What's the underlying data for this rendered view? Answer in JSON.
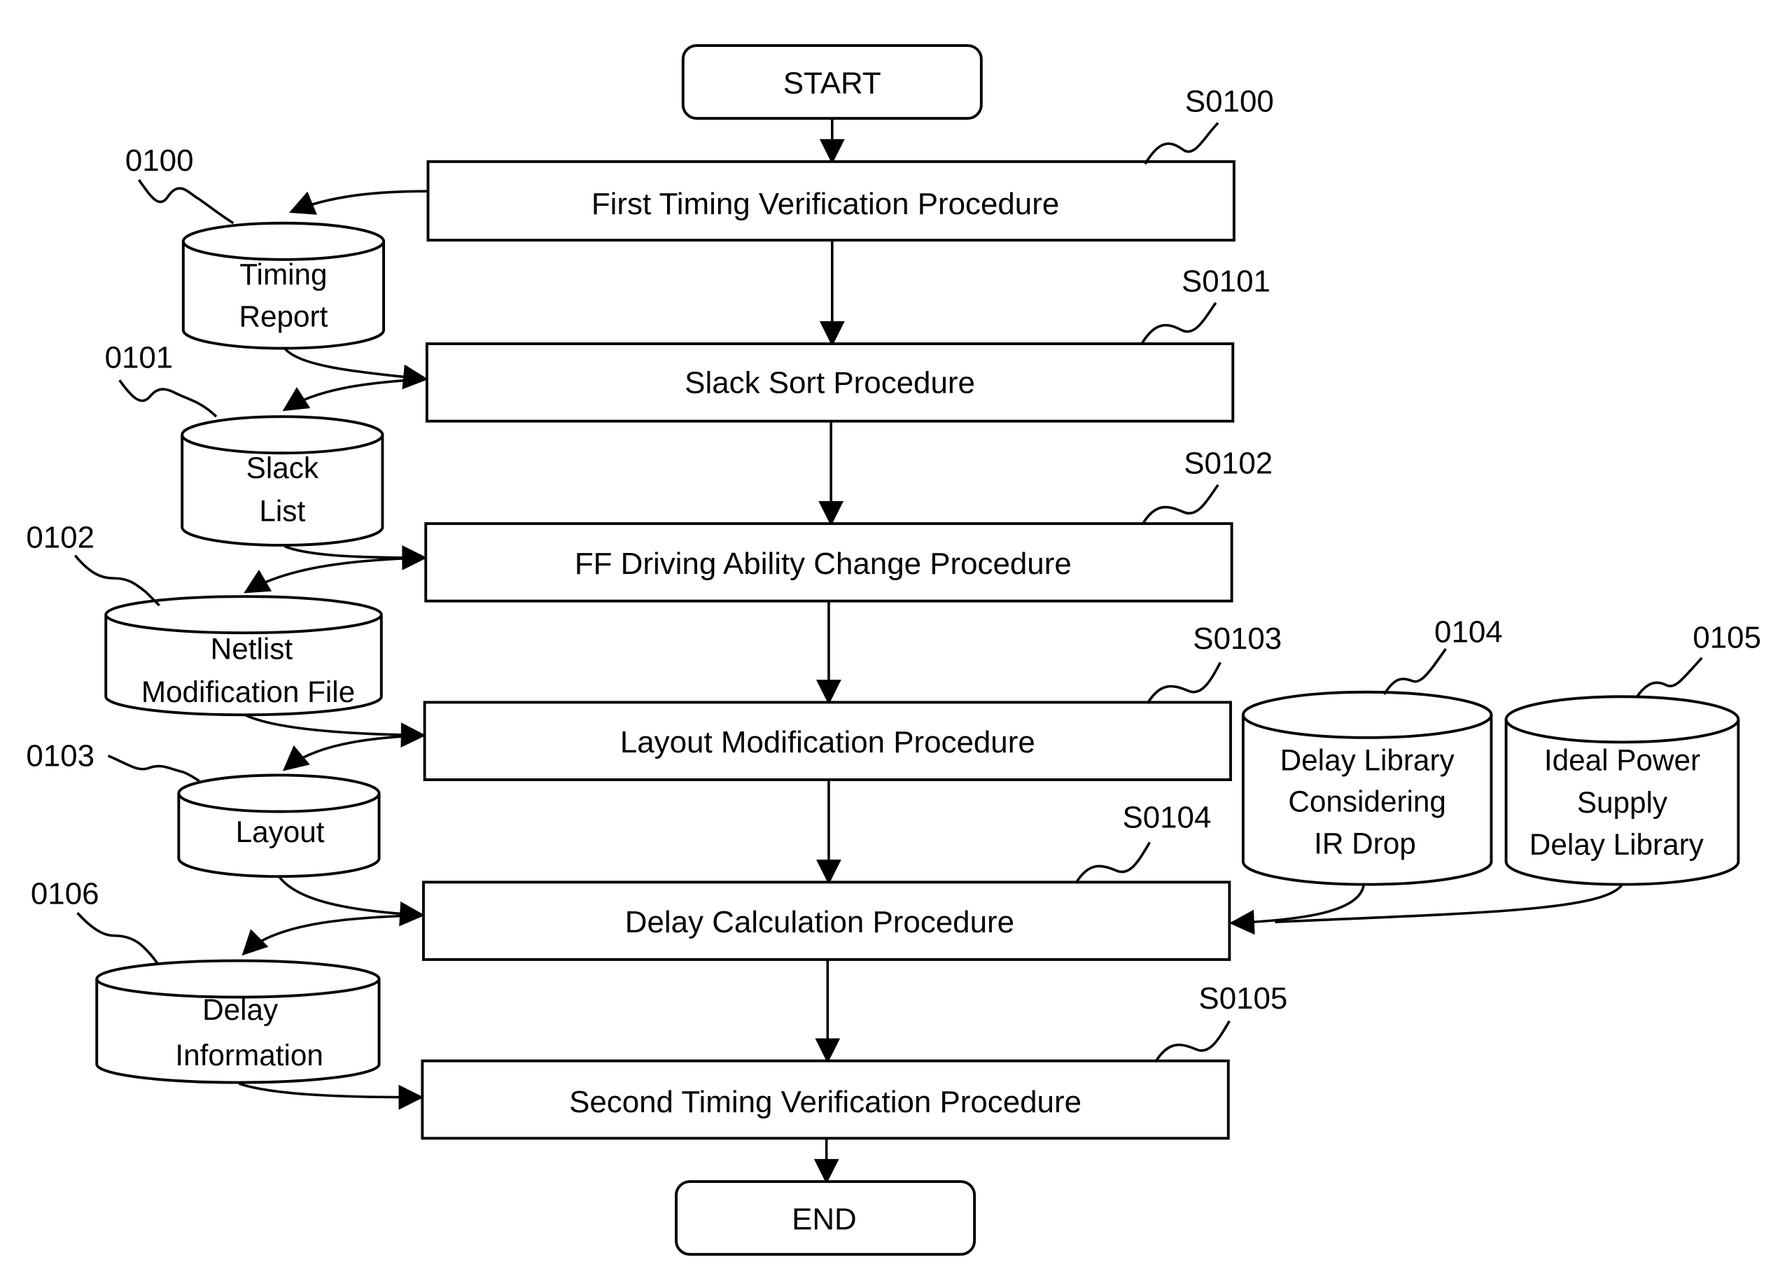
{
  "terminals": {
    "start": "START",
    "end": "END"
  },
  "steps": [
    {
      "id": "S0100",
      "label": "First Timing Verification Procedure"
    },
    {
      "id": "S0101",
      "label": "Slack Sort Procedure"
    },
    {
      "id": "S0102",
      "label": "FF Driving Ability Change Procedure"
    },
    {
      "id": "S0103",
      "label": "Layout Modification Procedure"
    },
    {
      "id": "S0104",
      "label": "Delay Calculation Procedure"
    },
    {
      "id": "S0105",
      "label": "Second Timing Verification Procedure"
    }
  ],
  "databases": [
    {
      "id": "0100",
      "lines": [
        "Timing",
        "Report"
      ]
    },
    {
      "id": "0101",
      "lines": [
        "Slack",
        "List"
      ]
    },
    {
      "id": "0102",
      "lines": [
        "Netlist",
        "Modification File"
      ]
    },
    {
      "id": "0103",
      "lines": [
        "Layout"
      ]
    },
    {
      "id": "0104",
      "lines": [
        "Delay Library",
        "Considering",
        "IR Drop"
      ]
    },
    {
      "id": "0105",
      "lines": [
        "Ideal Power",
        "Supply",
        "Delay Library"
      ]
    },
    {
      "id": "0106",
      "lines": [
        "Delay",
        "Information"
      ]
    }
  ]
}
